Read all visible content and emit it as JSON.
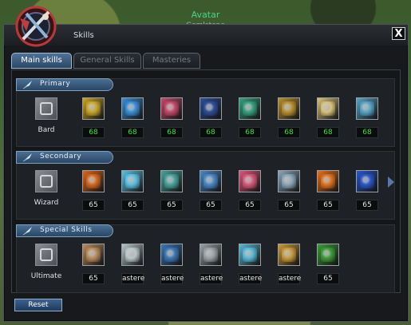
{
  "header": {
    "avatar_name": "Avatar",
    "avatar_subtitle": "Gemlstone"
  },
  "window": {
    "title": "Skills",
    "close_label": "X"
  },
  "tabs": [
    {
      "label": "Main skills",
      "active": true
    },
    {
      "label": "General Skills",
      "active": false
    },
    {
      "label": "Masteries",
      "active": false
    }
  ],
  "sections": [
    {
      "title": "Primary",
      "class_label": "Bard",
      "values_color": "#37e035",
      "skills": [
        {
          "icon": "lyre-gold-icon",
          "value": "68",
          "color": "#c9a726"
        },
        {
          "icon": "music-blue-icon",
          "value": "68",
          "color": "#3b8fd6"
        },
        {
          "icon": "heart-green-icon",
          "value": "68",
          "color": "#c44a6a"
        },
        {
          "icon": "shield-gold-icon",
          "value": "68",
          "color": "#2f4f98"
        },
        {
          "icon": "heart-teal-icon",
          "value": "68",
          "color": "#37a07e"
        },
        {
          "icon": "harp-gold-icon",
          "value": "68",
          "color": "#b99030"
        },
        {
          "icon": "cross-gold-icon",
          "value": "68",
          "color": "#d8c27a"
        },
        {
          "icon": "wave-blue-icon",
          "value": "68",
          "color": "#57a5c7"
        }
      ],
      "has_next": false
    },
    {
      "title": "Secondary",
      "class_label": "Wizard",
      "values_color": "#e6e6e6",
      "skills": [
        {
          "icon": "fireball-icon",
          "value": "65",
          "color": "#d7681f"
        },
        {
          "icon": "ice-bolt-icon",
          "value": "65",
          "color": "#5cc1e3"
        },
        {
          "icon": "ring-green-icon",
          "value": "65",
          "color": "#4aa19b"
        },
        {
          "icon": "ice-shard-icon",
          "value": "65",
          "color": "#4a88c4"
        },
        {
          "icon": "heart-pink-icon",
          "value": "65",
          "color": "#d9587a"
        },
        {
          "icon": "swirl-icon",
          "value": "65",
          "color": "#8aa7b9"
        },
        {
          "icon": "flame-orb-icon",
          "value": "65",
          "color": "#e0721e"
        },
        {
          "icon": "lightning-blue-icon",
          "value": "65",
          "color": "#2a58c9"
        }
      ],
      "has_next": true
    },
    {
      "title": "Special Skills",
      "class_label": "Ultimate",
      "values_color": "#e6e6e6",
      "skills": [
        {
          "icon": "scroll-icon",
          "value": "65",
          "color": "#b98c5e"
        },
        {
          "icon": "feather-icon",
          "value": "astere",
          "color": "#b9c7c9"
        },
        {
          "icon": "figure-blue-icon",
          "value": "astere",
          "color": "#3d78b4"
        },
        {
          "icon": "skull-icon",
          "value": "astere",
          "color": "#9aa3a7"
        },
        {
          "icon": "spirit-cyan-icon",
          "value": "astere",
          "color": "#58bad6"
        },
        {
          "icon": "gem-gold-icon",
          "value": "astere",
          "color": "#c99a3a"
        },
        {
          "icon": "leaf-green-icon",
          "value": "65",
          "color": "#3c9b3a"
        }
      ],
      "has_next": false
    }
  ],
  "reset_label": "Reset"
}
